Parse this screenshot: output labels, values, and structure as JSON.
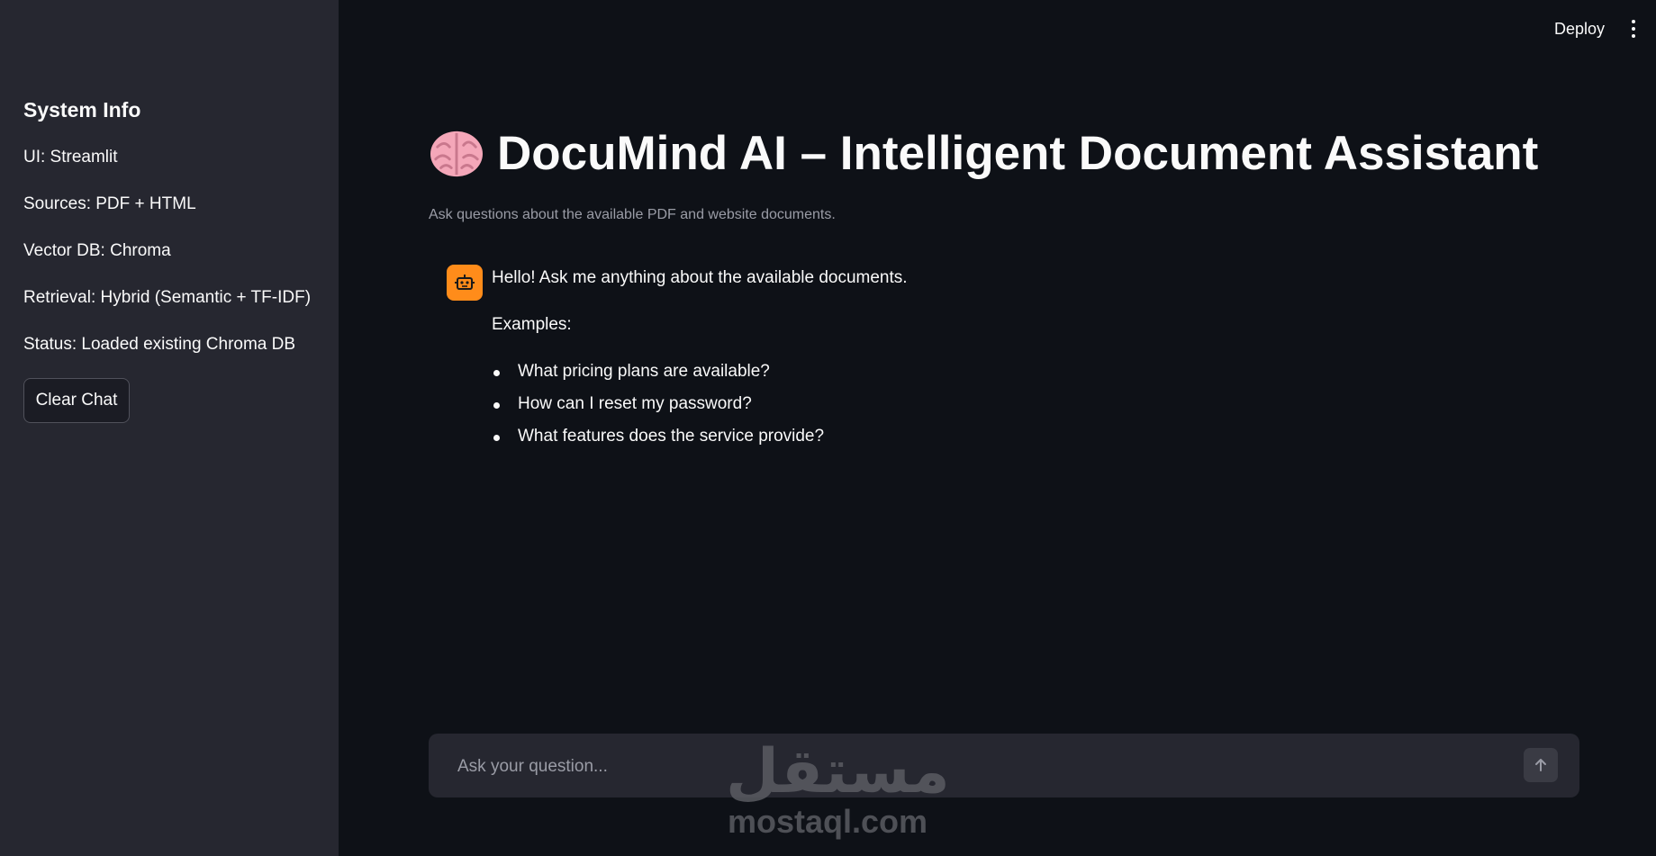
{
  "header": {
    "deploy_label": "Deploy",
    "menu_icon": "kebab-menu-icon"
  },
  "sidebar": {
    "title": "System Info",
    "items": [
      {
        "label": "UI: Streamlit"
      },
      {
        "label": "Sources: PDF + HTML"
      },
      {
        "label": "Vector DB: Chroma"
      },
      {
        "label": "Retrieval: Hybrid (Semantic + TF-IDF)"
      },
      {
        "label": "Status: Loaded existing Chroma DB"
      }
    ],
    "clear_label": "Clear Chat"
  },
  "main": {
    "title_icon": "brain-icon",
    "title": "DocuMind AI – Intelligent Document Assistant",
    "subtitle": "Ask questions about the available PDF and website documents."
  },
  "chat": {
    "avatar_icon": "robot-icon",
    "avatar_color": "#ff8c1a",
    "greeting": "Hello! Ask me anything about the available documents.",
    "examples_label": "Examples:",
    "examples": [
      "What pricing plans are available?",
      "How can I reset my password?",
      "What features does the service provide?"
    ]
  },
  "input": {
    "placeholder": "Ask your question...",
    "value": "",
    "send_icon": "arrow-up-icon"
  },
  "watermark": {
    "arabic": "مستقل",
    "latin": "mostaql.com"
  },
  "colors": {
    "background": "#0e1117",
    "sidebar": "#262730",
    "accent": "#ff8c1a"
  }
}
